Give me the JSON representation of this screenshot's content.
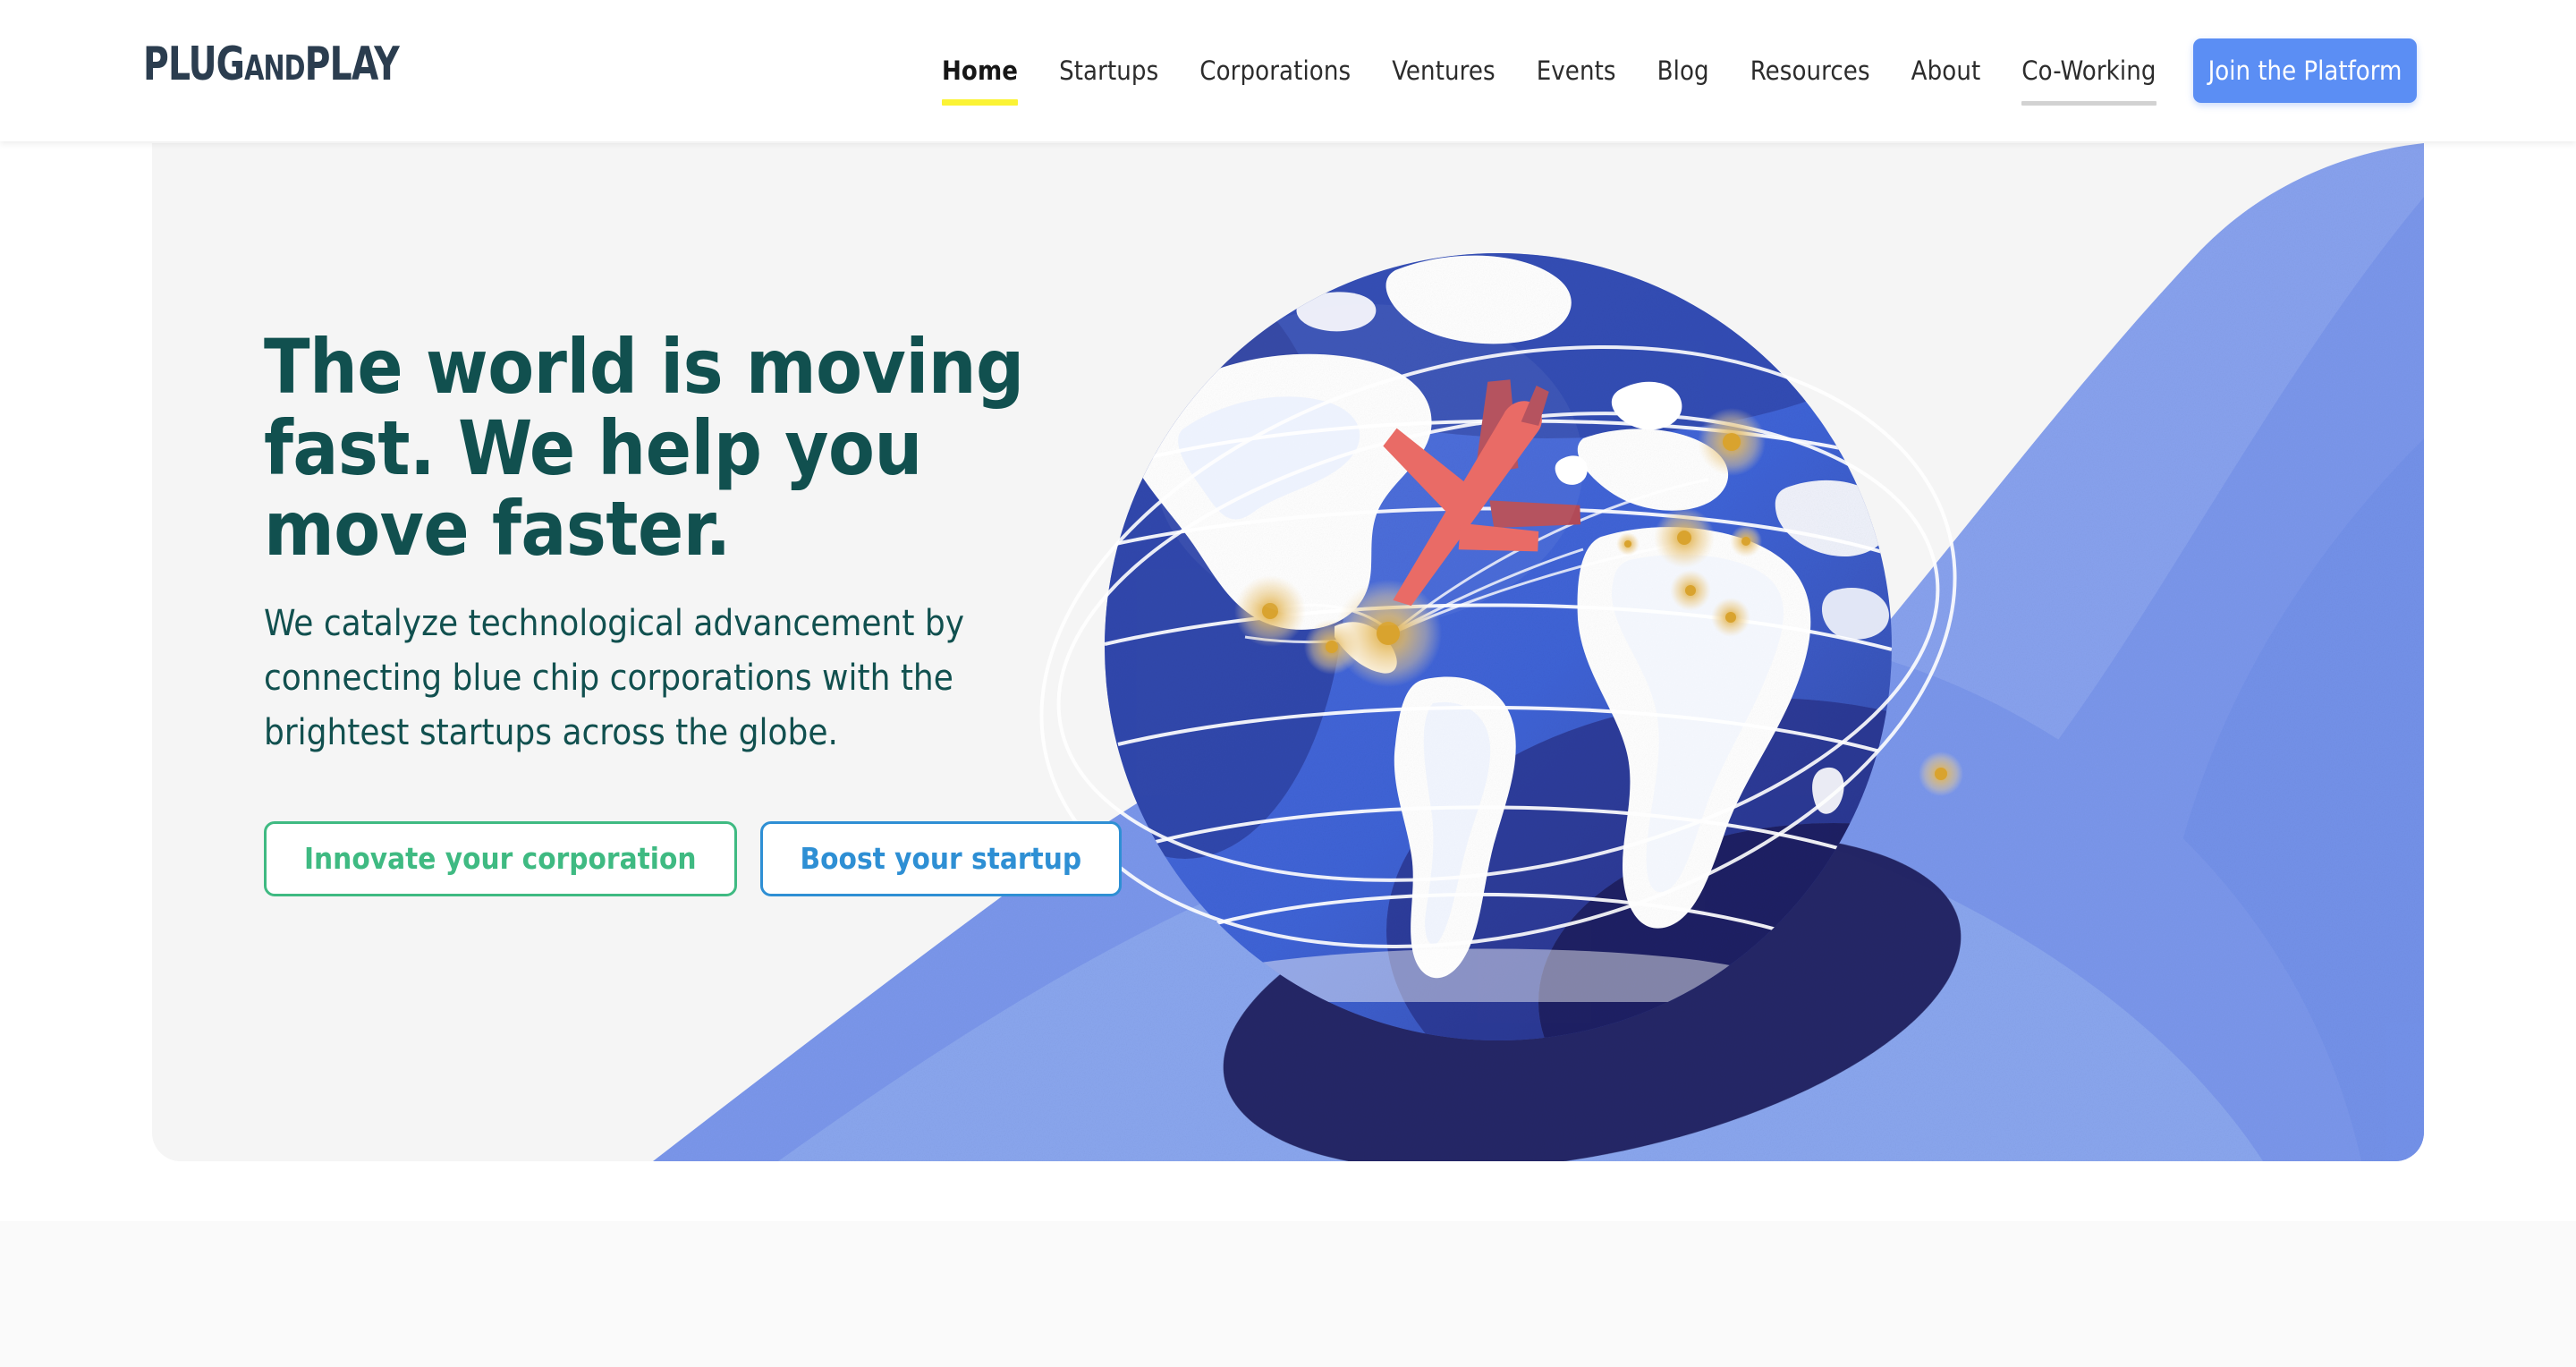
{
  "header": {
    "logo": {
      "part1": "PLUG",
      "part2": "AND",
      "part3": "PLAY"
    },
    "nav_items": [
      {
        "label": "Home",
        "state": "active",
        "underline": "yellow"
      },
      {
        "label": "Startups",
        "state": "default",
        "underline": "none"
      },
      {
        "label": "Corporations",
        "state": "default",
        "underline": "none"
      },
      {
        "label": "Ventures",
        "state": "default",
        "underline": "none"
      },
      {
        "label": "Events",
        "state": "default",
        "underline": "none"
      },
      {
        "label": "Blog",
        "state": "default",
        "underline": "none"
      },
      {
        "label": "Resources",
        "state": "default",
        "underline": "none"
      },
      {
        "label": "About",
        "state": "default",
        "underline": "none"
      },
      {
        "label": "Co-Working",
        "state": "hover",
        "underline": "gray"
      }
    ],
    "cta_button": {
      "label": "Join the Platform",
      "color": "#5b8ef4",
      "text_color": "#ffffff"
    }
  },
  "hero": {
    "title": "The world is moving\nfast. We help you\nmove faster.",
    "subtitle": "We catalyze technological advancement by\nconnecting blue chip corporations with the\nbrightest startups across the globe.",
    "buttons": [
      {
        "label": "Innovate your corporation",
        "color": "#3fba82"
      },
      {
        "label": "Boost your startup",
        "color": "#2e8fd4"
      }
    ],
    "illustration": {
      "name": "globe-with-airplane-illustration",
      "background": "#f5f5f5",
      "globe_ocean": "#3f63d6",
      "globe_ocean_dark": "#2b3f9e",
      "globe_shadow": "#1b1f5c",
      "land": "#ffffff",
      "wave": "#7b97eb",
      "wave_light": "#8fa6ef",
      "airplane": "#e8645e",
      "airplane_dark": "#b14a57",
      "hotspot": "#e9c478",
      "hotspot_core": "#dba93f",
      "arc_line": "#ffffff"
    }
  },
  "colors": {
    "page_background": "#ffffff",
    "hero_card_background": "#f5f5f5",
    "next_section_background": "#fafafa",
    "heading_text": "#11504f",
    "nav_text": "#2c2c2c",
    "accent_yellow": "#fbf335",
    "logo": "#2b3d4f"
  }
}
